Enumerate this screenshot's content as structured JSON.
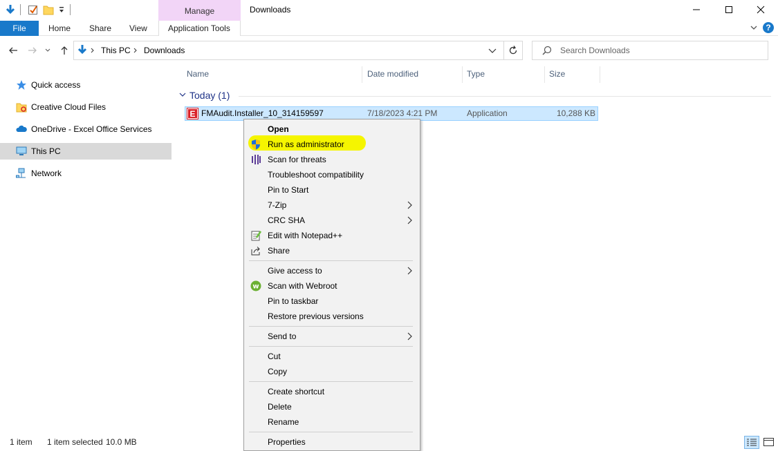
{
  "window": {
    "title": "Downloads",
    "contextual_tab_group": "Manage",
    "controls": [
      "—",
      "☐",
      "✕"
    ]
  },
  "ribbon": {
    "tabs": [
      "File",
      "Home",
      "Share",
      "View",
      "Application Tools"
    ],
    "accent": "#1979ca",
    "contextual_color": "#f2d5f7"
  },
  "address": {
    "path": [
      "This PC",
      "Downloads"
    ],
    "search_placeholder": "Search Downloads"
  },
  "sidebar": {
    "items": [
      {
        "label": "Quick access",
        "icon": "star-icon"
      },
      {
        "label": "Creative Cloud Files",
        "icon": "creative-cloud-icon"
      },
      {
        "label": "OneDrive - Excel Office Services",
        "icon": "cloud-icon"
      },
      {
        "label": "This PC",
        "icon": "computer-icon",
        "selected": true
      },
      {
        "label": "Network",
        "icon": "network-icon"
      }
    ]
  },
  "columns": [
    "Name",
    "Date modified",
    "Type",
    "Size"
  ],
  "group": {
    "label": "Today (1)"
  },
  "files": [
    {
      "name": "FMAudit.Installer_10_314159597",
      "date": "7/18/2023 4:21 PM",
      "type": "Application",
      "size": "10,288 KB",
      "icon_letter": "E"
    }
  ],
  "context_menu": {
    "items": [
      {
        "label": "Open",
        "bold": true
      },
      {
        "label": "Run as administrator",
        "icon": "uac-shield-icon",
        "highlighted": true
      },
      {
        "label": "Scan for threats",
        "icon": "scan-icon"
      },
      {
        "label": "Troubleshoot compatibility"
      },
      {
        "label": "Pin to Start"
      },
      {
        "label": "7-Zip",
        "submenu": true
      },
      {
        "label": "CRC SHA",
        "submenu": true
      },
      {
        "label": "Edit with Notepad++",
        "icon": "notepad-icon"
      },
      {
        "label": "Share",
        "icon": "share-icon"
      },
      {
        "label": "Give access to",
        "submenu": true
      },
      {
        "label": "Scan with Webroot",
        "icon": "webroot-icon"
      },
      {
        "label": "Pin to taskbar"
      },
      {
        "label": "Restore previous versions"
      },
      {
        "label": "Send to",
        "submenu": true
      },
      {
        "label": "Cut"
      },
      {
        "label": "Copy"
      },
      {
        "label": "Create shortcut"
      },
      {
        "label": "Delete"
      },
      {
        "label": "Rename"
      },
      {
        "label": "Properties"
      }
    ],
    "highlight_color": "#f5f500"
  },
  "status": {
    "count": "1 item",
    "selected": "1 item selected",
    "size": "10.0 MB"
  }
}
